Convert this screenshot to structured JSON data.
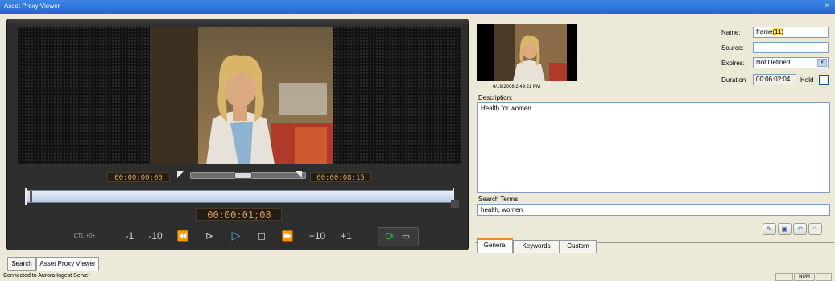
{
  "window": {
    "title": "Asset Proxy Viewer",
    "close_icon": "close-icon"
  },
  "player": {
    "mark_in": "00:00:00:00",
    "mark_out": "00:00:08:15",
    "current_time": "00:00:01;08",
    "trim_position": 0.45,
    "ctl_label": "CTL +0+",
    "controls": {
      "step_back_1": "-1",
      "step_back_10": "-10",
      "rewind_icon": "rewind-icon",
      "jump_to_in_icon": "jump-to-in-icon",
      "play_icon": "play-icon",
      "stop_icon": "stop-icon",
      "fast_forward_icon": "fast-forward-icon",
      "step_forward_10": "+10",
      "step_forward_1": "+1",
      "loop_icon": "loop-icon",
      "chat_icon": "speech-bubble-icon"
    },
    "colors": {
      "timecode_text": "#c9a06a",
      "play_button": "#59a6e6",
      "loop_icon": "#2fb05a"
    }
  },
  "asset": {
    "thumbnail_timestamp": "6/19/2008 2:49:21 PM",
    "name_label": "Name:",
    "name_value_prefix": "frame",
    "name_value_highlight": "(11)",
    "source_label": "Source:",
    "source_value": "",
    "expires_label": "Expires:",
    "expires_value": "Not Defined",
    "duration_label": "Duration",
    "duration_value": "00:06:02:04",
    "hold_label": "Hold",
    "hold_checked": false,
    "description_label": "Description:",
    "description_value": "Health for women",
    "search_terms_label": "Search Terms:",
    "search_terms_value": "health, women"
  },
  "action_icons": [
    "edit-icon",
    "save-icon",
    "undo-icon",
    "redo-icon"
  ],
  "tabs": [
    {
      "label": "General",
      "active": true
    },
    {
      "label": "Keywords",
      "active": false
    },
    {
      "label": "Custom",
      "active": false
    }
  ],
  "window_tabs": [
    {
      "label": "Search",
      "active": false
    },
    {
      "label": "Asset Proxy Viewer",
      "active": true
    }
  ],
  "status": {
    "text": "Connected to Aurora Ingest Server",
    "num_lock": "NUM"
  }
}
